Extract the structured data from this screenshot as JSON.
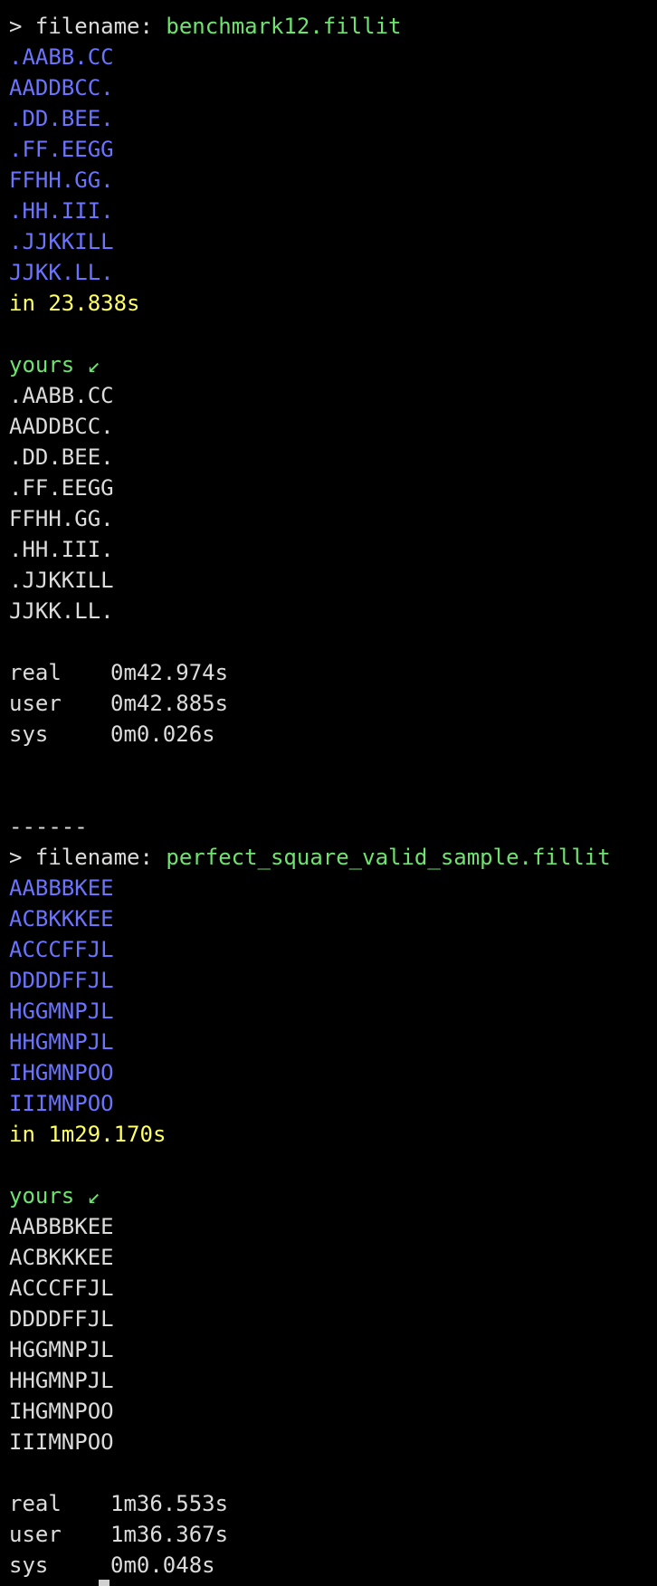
{
  "colors": {
    "background": "#000000",
    "text": "#dcdcdc",
    "filename": "#6fe36f",
    "expected_grid": "#6b73ff",
    "timing": "#ffff66",
    "yours_label": "#6fe36f"
  },
  "prompt": "> filename: ",
  "separator": "------",
  "stat_labels": {
    "real": "real",
    "user": "user",
    "sys": "sys"
  },
  "blocks": [
    {
      "filename": "benchmark12.fillit",
      "expected": [
        ".AABB.CC",
        "AADDBCC.",
        ".DD.BEE.",
        ".FF.EEGG",
        "FFHH.GG.",
        ".HH.III.",
        ".JJKKILL",
        "JJKK.LL."
      ],
      "time_text": "in 23.838s",
      "yours_label": "yours ↙",
      "yours": [
        ".AABB.CC",
        "AADDBCC.",
        ".DD.BEE.",
        ".FF.EEGG",
        "FFHH.GG.",
        ".HH.III.",
        ".JJKKILL",
        "JJKK.LL."
      ],
      "real": "0m42.974s",
      "user": "0m42.885s",
      "sys": "0m0.026s"
    },
    {
      "filename": "perfect_square_valid_sample.fillit",
      "expected": [
        "AABBBKEE",
        "ACBKKKEE",
        "ACCCFFJL",
        "DDDDFFJL",
        "HGGMNPJL",
        "HHGMNPJL",
        "IHGMNPOO",
        "IIIMNPOO"
      ],
      "time_text": "in 1m29.170s",
      "yours_label": "yours ↙",
      "yours": [
        "AABBBKEE",
        "ACBKKKEE",
        "ACCCFFJL",
        "DDDDFFJL",
        "HGGMNPJL",
        "HHGMNPJL",
        "IHGMNPOO",
        "IIIMNPOO"
      ],
      "real": "1m36.553s",
      "user": "1m36.367s",
      "sys": "0m0.048s"
    }
  ]
}
